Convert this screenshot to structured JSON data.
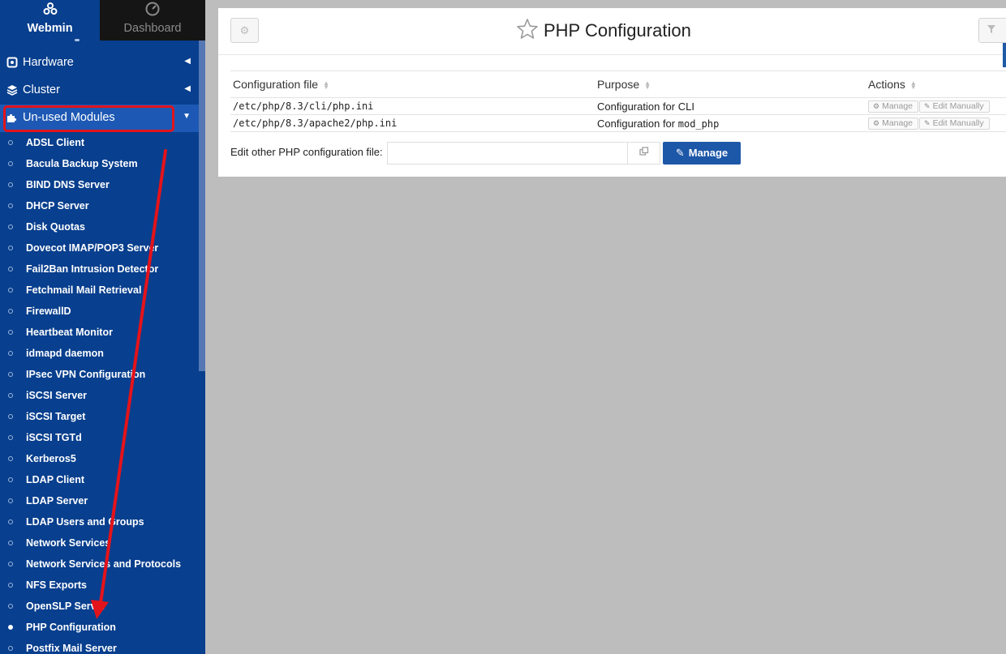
{
  "sidebar": {
    "tabs": [
      {
        "label": "Webmin",
        "icon": "webmin-logo-icon",
        "active": true
      },
      {
        "label": "Dashboard",
        "icon": "dashboard-gauge-icon",
        "active": false
      }
    ],
    "categories": {
      "hardware": {
        "label": "Hardware",
        "caret": "◀"
      },
      "cluster": {
        "label": "Cluster",
        "caret": "◀"
      },
      "unused": {
        "label": "Un-used Modules",
        "caret": "▼",
        "expanded": true
      }
    },
    "modules": [
      "ADSL Client",
      "Bacula Backup System",
      "BIND DNS Server",
      "DHCP Server",
      "Disk Quotas",
      "Dovecot IMAP/POP3 Server",
      "Fail2Ban Intrusion Detector",
      "Fetchmail Mail Retrieval",
      "FirewallD",
      "Heartbeat Monitor",
      "idmapd daemon",
      "IPsec VPN Configuration",
      "iSCSI Server",
      "iSCSI Target",
      "iSCSI TGTd",
      "Kerberos5",
      "LDAP Client",
      "LDAP Server",
      "LDAP Users and Groups",
      "Network Services",
      "Network Services and Protocols",
      "NFS Exports",
      "OpenSLP Server",
      "PHP Configuration",
      "Postfix Mail Server"
    ],
    "active_module": "PHP Configuration"
  },
  "header": {
    "title": "PHP Configuration",
    "gear_icon": "⚙",
    "filter_icon": "▼"
  },
  "table": {
    "columns": [
      "Configuration file",
      "Purpose",
      "Actions"
    ],
    "rows": [
      {
        "file": "/etc/php/8.3/cli/php.ini",
        "purpose": "Configuration for CLI",
        "purpose_code": "",
        "manage": "Manage",
        "edit": "Edit Manually"
      },
      {
        "file": "/etc/php/8.3/apache2/php.ini",
        "purpose": "Configuration for",
        "purpose_code": "mod_php",
        "manage": "Manage",
        "edit": "Edit Manually"
      }
    ]
  },
  "edit_other": {
    "label": "Edit other PHP configuration file:",
    "value": "",
    "placeholder": "",
    "button_label": "Manage"
  },
  "colors": {
    "sidebar_bg": "#083f8e",
    "sidebar_highlight": "#1d59b4",
    "accent": "#1d57a8",
    "annotation_red": "#e3131b"
  }
}
